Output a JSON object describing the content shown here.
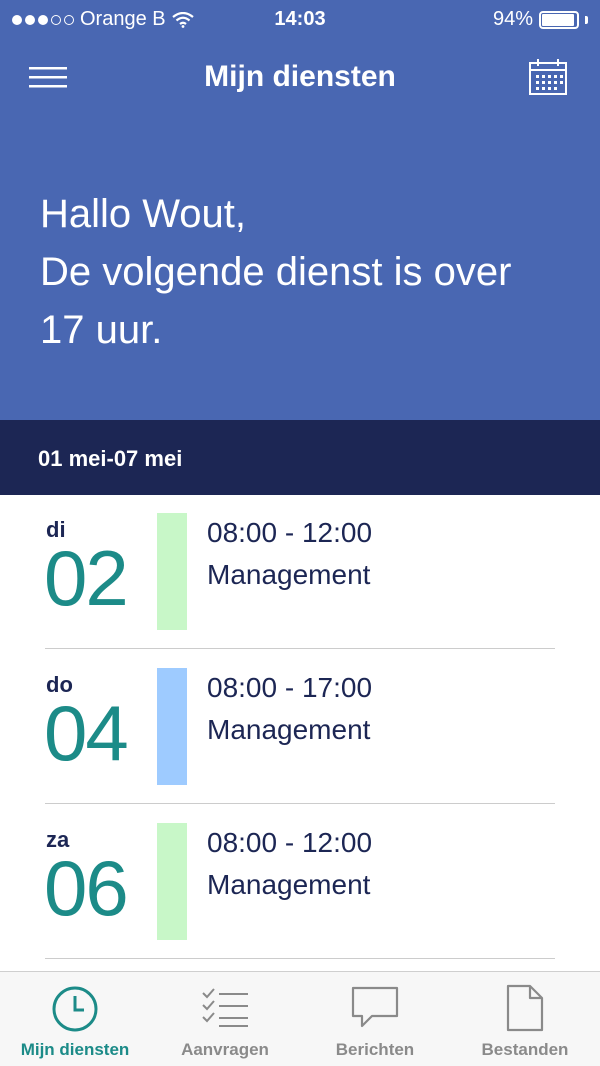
{
  "status_bar": {
    "carrier": "Orange B",
    "time": "14:03",
    "battery": "94%",
    "battery_level": 0.94,
    "signal_bars": 3
  },
  "nav": {
    "title": "Mijn diensten",
    "menu_icon": "hamburger-menu-icon",
    "calendar_icon": "calendar-icon"
  },
  "greeting": {
    "line1": "Hallo Wout,",
    "line2": "De volgende dienst is over",
    "line3": "17 uur."
  },
  "week": {
    "range": "01 mei-07 mei"
  },
  "shifts": [
    {
      "weekday": "di",
      "day": "02",
      "time": "08:00 - 12:00",
      "department": "Management",
      "color": "#c8f7c8"
    },
    {
      "weekday": "do",
      "day": "04",
      "time": "08:00 - 17:00",
      "department": "Management",
      "color": "#9ecbff"
    },
    {
      "weekday": "za",
      "day": "06",
      "time": "08:00 - 12:00",
      "department": "Management",
      "color": "#c8f7c8"
    }
  ],
  "tabs": [
    {
      "label": "Mijn diensten",
      "icon": "clock-icon",
      "active": true
    },
    {
      "label": "Aanvragen",
      "icon": "checklist-icon",
      "active": false
    },
    {
      "label": "Berichten",
      "icon": "speech-bubble-icon",
      "active": false
    },
    {
      "label": "Bestanden",
      "icon": "document-icon",
      "active": false
    }
  ],
  "colors": {
    "header_bg": "#4967b2",
    "week_bar_bg": "#1c2654",
    "accent": "#1c8b88",
    "text_dark": "#1c2654"
  }
}
